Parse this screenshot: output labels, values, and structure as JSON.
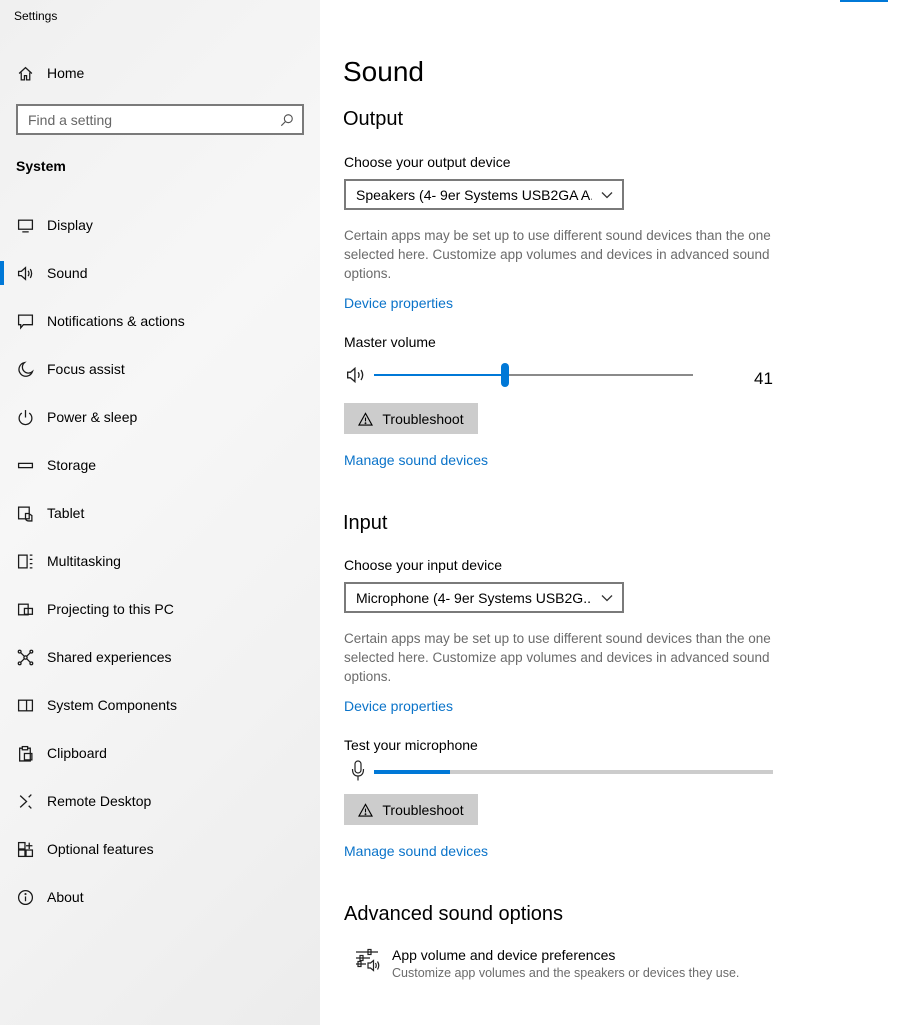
{
  "app": {
    "title": "Settings"
  },
  "sidebar": {
    "home_label": "Home",
    "search_placeholder": "Find a setting",
    "section_label": "System",
    "items": [
      {
        "label": "Display",
        "icon": "monitor-icon",
        "active": false
      },
      {
        "label": "Sound",
        "icon": "speaker-icon",
        "active": true
      },
      {
        "label": "Notifications & actions",
        "icon": "notification-icon",
        "active": false
      },
      {
        "label": "Focus assist",
        "icon": "moon-icon",
        "active": false
      },
      {
        "label": "Power & sleep",
        "icon": "power-icon",
        "active": false
      },
      {
        "label": "Storage",
        "icon": "storage-icon",
        "active": false
      },
      {
        "label": "Tablet",
        "icon": "tablet-icon",
        "active": false
      },
      {
        "label": "Multitasking",
        "icon": "multitasking-icon",
        "active": false
      },
      {
        "label": "Projecting to this PC",
        "icon": "projector-icon",
        "active": false
      },
      {
        "label": "Shared experiences",
        "icon": "shared-icon",
        "active": false
      },
      {
        "label": "System Components",
        "icon": "components-icon",
        "active": false
      },
      {
        "label": "Clipboard",
        "icon": "clipboard-icon",
        "active": false
      },
      {
        "label": "Remote Desktop",
        "icon": "remote-desktop-icon",
        "active": false
      },
      {
        "label": "Optional features",
        "icon": "optional-features-icon",
        "active": false
      },
      {
        "label": "About",
        "icon": "info-icon",
        "active": false
      }
    ]
  },
  "main": {
    "page_title": "Sound",
    "output": {
      "heading": "Output",
      "device_label": "Choose your output device",
      "device_value": "Speakers (4- 9er Systems USB2GA A...",
      "description": "Certain apps may be set up to use different sound devices than the one selected here. Customize app volumes and devices in advanced sound options.",
      "device_properties_link": "Device properties",
      "master_volume_label": "Master volume",
      "master_volume_value": "41",
      "master_volume_fraction": 0.41,
      "troubleshoot_label": "Troubleshoot",
      "manage_devices_link": "Manage sound devices"
    },
    "input": {
      "heading": "Input",
      "device_label": "Choose your input device",
      "device_value": "Microphone (4- 9er Systems USB2G...",
      "description": "Certain apps may be set up to use different sound devices than the one selected here. Customize app volumes and devices in advanced sound options.",
      "device_properties_link": "Device properties",
      "test_mic_label": "Test your microphone",
      "mic_level_fraction": 0.19,
      "troubleshoot_label": "Troubleshoot",
      "manage_devices_link": "Manage sound devices"
    },
    "advanced": {
      "heading": "Advanced sound options",
      "app_volume_title": "App volume and device preferences",
      "app_volume_subtitle": "Customize app volumes and the speakers or devices they use."
    }
  },
  "colors": {
    "accent": "#0078d7",
    "link": "#0a73c9",
    "button_bg": "#cccccc"
  }
}
